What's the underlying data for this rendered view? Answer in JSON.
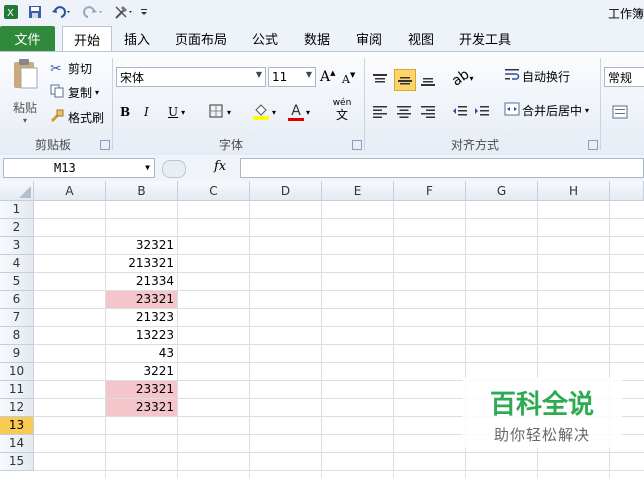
{
  "app": {
    "title": "工作簿"
  },
  "quick_access": [
    "excel-logo-icon",
    "save-icon",
    "undo-icon",
    "redo-icon",
    "tools-icon",
    "customize-icon"
  ],
  "tabs": [
    "文件",
    "开始",
    "插入",
    "页面布局",
    "公式",
    "数据",
    "审阅",
    "视图",
    "开发工具"
  ],
  "clipboard": {
    "paste": "粘贴",
    "cut": "剪切",
    "copy": "复制",
    "format_painter": "格式刷",
    "group": "剪贴板"
  },
  "font": {
    "name": "宋体",
    "size": "11",
    "bold": "B",
    "italic": "I",
    "underline": "U",
    "group": "字体",
    "font_color_letter": "A",
    "grow": "A",
    "shrink": "A",
    "wen": "wén",
    "wen_char": "文"
  },
  "alignment": {
    "wrap": "自动换行",
    "merge": "合并后居中",
    "group": "对齐方式"
  },
  "number": {
    "format": "常规"
  },
  "formula_bar": {
    "name_box": "M13",
    "fx": "fx",
    "value": ""
  },
  "sheet": {
    "columns": [
      "A",
      "B",
      "C",
      "D",
      "E",
      "F",
      "G",
      "H"
    ],
    "rows": [
      "1",
      "2",
      "3",
      "4",
      "5",
      "6",
      "7",
      "8",
      "9",
      "10",
      "11",
      "12",
      "13",
      "14",
      "15"
    ],
    "active_row": "13",
    "b_values": [
      "",
      "",
      "32321",
      "213321",
      "21334",
      "23321",
      "21323",
      "13223",
      "43",
      "3221",
      "23321",
      "23321",
      "",
      "",
      ""
    ],
    "highlighted_rows": [
      "6",
      "11",
      "12"
    ],
    "highlight_color": "#f5c5cc"
  },
  "watermark": {
    "main": "百科全说",
    "sub": "助你轻松解决"
  }
}
